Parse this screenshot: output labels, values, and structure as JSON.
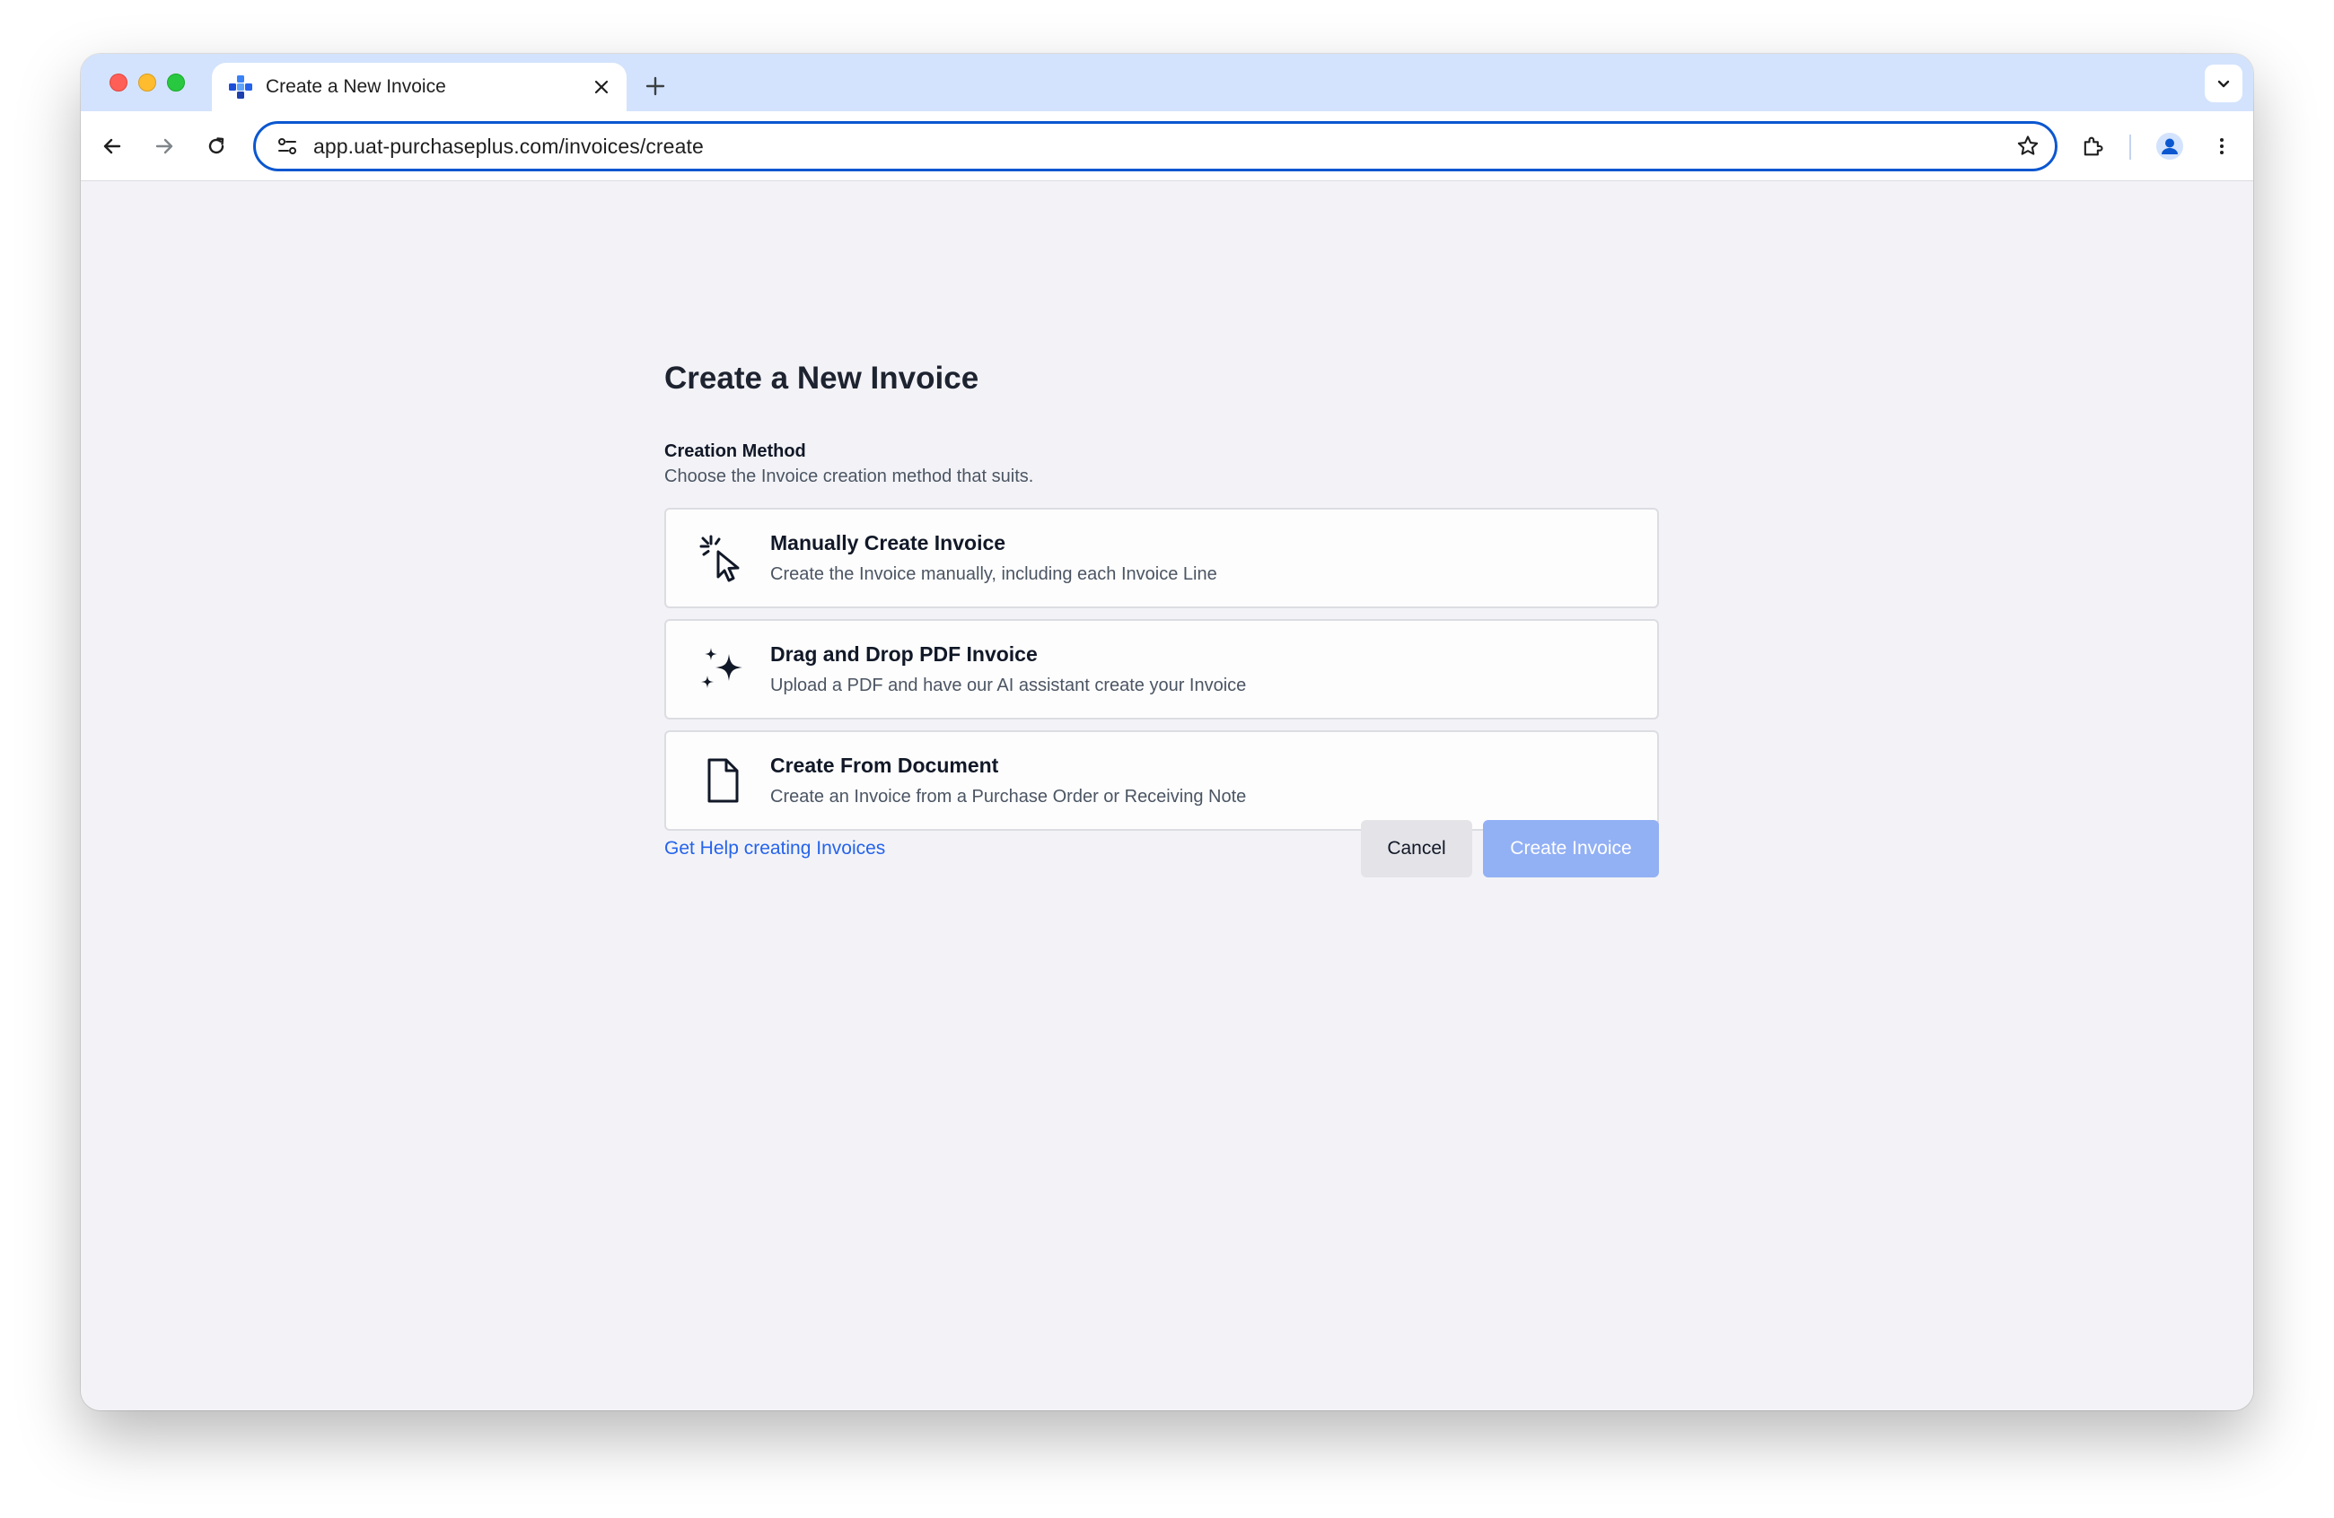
{
  "browser": {
    "tab": {
      "title": "Create a New Invoice",
      "favicon": "purchaseplus-logo"
    },
    "address_bar": {
      "url": "app.uat-purchaseplus.com/invoices/create"
    },
    "accent_color": "#0b57d0",
    "tabstrip_color": "#d3e3fd"
  },
  "page": {
    "title": "Create a New Invoice",
    "section": {
      "label": "Creation Method",
      "description": "Choose the Invoice creation method that suits."
    },
    "options": [
      {
        "icon": "cursor-click-icon",
        "title": "Manually Create Invoice",
        "description": "Create the Invoice manually, including each Invoice Line"
      },
      {
        "icon": "sparkles-icon",
        "title": "Drag and Drop PDF Invoice",
        "description": "Upload a PDF and have our AI assistant create your Invoice"
      },
      {
        "icon": "document-icon",
        "title": "Create From Document",
        "description": "Create an Invoice from a Purchase Order or Receiving Note"
      }
    ],
    "help_link": "Get Help creating Invoices",
    "buttons": {
      "cancel": "Cancel",
      "create": "Create Invoice"
    },
    "colors": {
      "link": "#2563eb",
      "primary_disabled": "#92b0f4",
      "background": "#f3f3f7"
    }
  }
}
